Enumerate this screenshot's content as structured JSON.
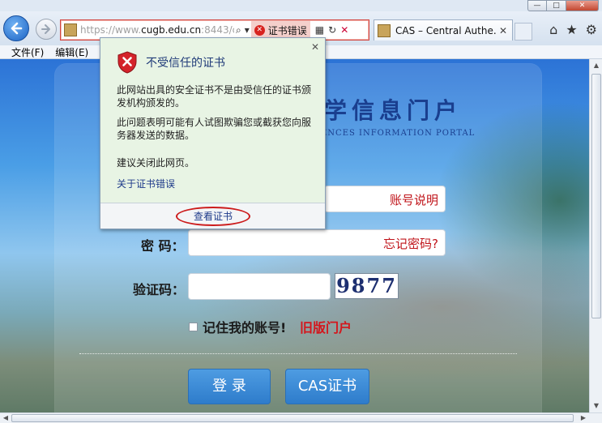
{
  "window": {
    "controls": {
      "minimize": "—",
      "maximize": "□",
      "close": "✕"
    }
  },
  "toolbar": {
    "address": {
      "url_scheme": "https://www.",
      "url_host": "cugb.edu.cn",
      "url_rest": ":8443/ca",
      "cert_error_label": "证书错误"
    },
    "tab": {
      "title": "CAS – Central Authe...",
      "close": "✕"
    }
  },
  "menu": {
    "file": "文件(F)",
    "edit": "编辑(E)"
  },
  "page": {
    "portal_title": "学信息门户",
    "portal_subtitle": "ENCES   INFORMATION PORTAL",
    "account_help": "账号说明",
    "password_label": "密 码：",
    "forgot_password": "忘记密码?",
    "captcha_label": "验证码：",
    "captcha_text": "9877",
    "remember_label": "记住我的账号!",
    "old_portal": "旧版门户",
    "login_button": "登  录",
    "cas_cert_button": "CAS证书"
  },
  "popup": {
    "title": "不受信任的证书",
    "para1": "此网站出具的安全证书不是由受信任的证书颁发机构颁发的。",
    "para2": "此问题表明可能有人试图欺骗您或截获您向服务器发送的数据。",
    "para3": "建议关闭此网页。",
    "link": "关于证书错误",
    "view_cert": "查看证书",
    "close": "✕"
  },
  "colors": {
    "error_red": "#cc1b1b",
    "link_blue": "#1e3a8a",
    "button_blue": "#3a88d6"
  }
}
